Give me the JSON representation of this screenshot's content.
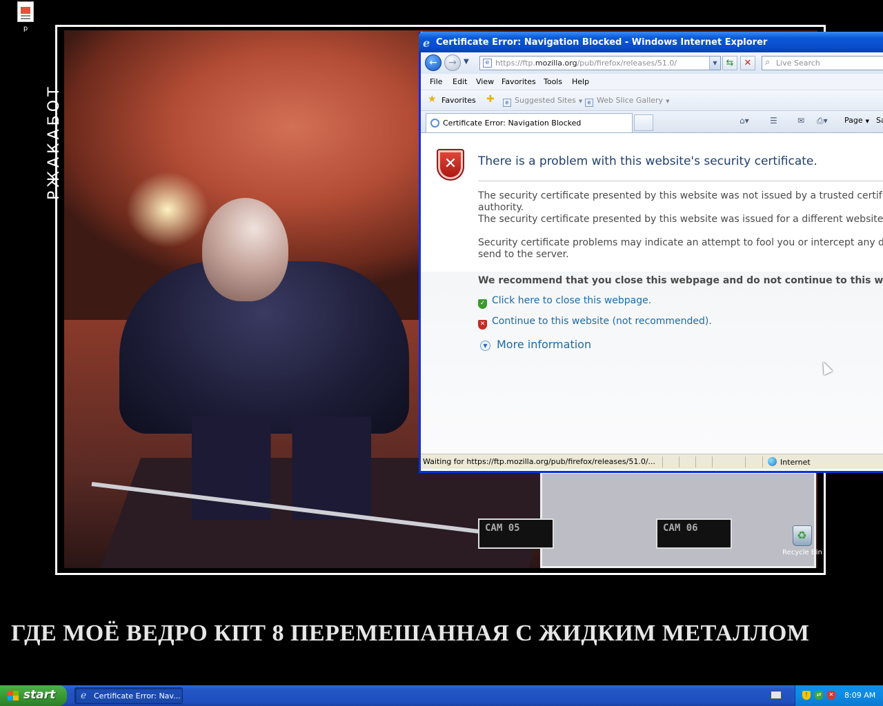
{
  "desktop": {
    "file_icon_label": "p",
    "recycle_bin_label": "Recycle Bin",
    "wallpaper": {
      "vertical_text": "РЖАКАБОТ",
      "caption": "ГДЕ МОЁ ВЕДРО КПТ 8 ПЕРЕМЕШАННАЯ С ЖИДКИМ МЕТАЛЛОМ",
      "cam_labels": [
        "CAM 05",
        "CAM 06"
      ]
    }
  },
  "ie": {
    "window_title": "Certificate Error: Navigation Blocked - Windows Internet Explorer",
    "address": {
      "scheme": "https://ftp.",
      "host": "mozilla.org",
      "path": "/pub/firefox/releases/51.0/"
    },
    "search_placeholder": "Live Search",
    "menu": [
      "File",
      "Edit",
      "View",
      "Favorites",
      "Tools",
      "Help"
    ],
    "favorites_bar": {
      "favorites_label": "Favorites",
      "items": [
        "Suggested Sites",
        "Web Slice Gallery"
      ]
    },
    "tab_title": "Certificate Error: Navigation Blocked",
    "command_bar": {
      "page_label": "Page",
      "safety_label_partial": "Sa"
    },
    "error_page": {
      "heading": "There is a problem with this website's security certificate.",
      "para1_line1": "The security certificate presented by this website was not issued by a trusted certif",
      "para1_line2": "authority.",
      "para1_line3": "The security certificate presented by this website was issued for a different website",
      "para2_line1": "Security certificate problems may indicate an attempt to fool you or intercept any d",
      "para2_line2": "send to the server.",
      "recommendation": "We recommend that you close this webpage and do not continue to this we",
      "close_link": "Click here to close this webpage.",
      "continue_link": "Continue to this website (not recommended).",
      "more_info": "More information"
    },
    "status": {
      "text": "Waiting for https://ftp.mozilla.org/pub/firefox/releases/51.0/...",
      "zone": "Internet"
    }
  },
  "taskbar": {
    "start_label": "start",
    "task_button": "Certificate Error: Nav...",
    "clock": "8:09 AM"
  },
  "colors": {
    "ie_link": "#1d6aa5",
    "error_heading": "#1f3f6e",
    "taskbar_blue": "#245ac6",
    "start_green": "#3a9a34"
  }
}
